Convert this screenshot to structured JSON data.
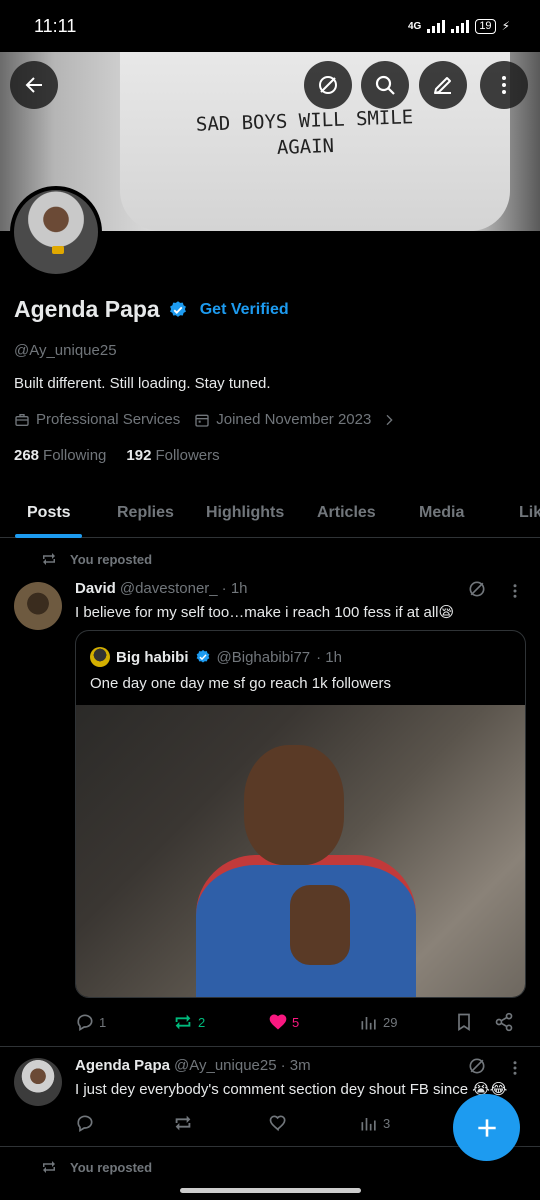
{
  "status_bar": {
    "time": "11:11",
    "network": "4G",
    "battery": "19"
  },
  "banner": {
    "shirt_text_line1": "SAD BOYS WILL SMILE",
    "shirt_text_line2": "AGAIN"
  },
  "profile": {
    "name": "Agenda Papa",
    "get_verified": "Get Verified",
    "handle": "@Ay_unique25",
    "bio": "Built different. Still loading. Stay tuned.",
    "category": "Professional Services",
    "joined": "Joined November 2023",
    "following_count": "268",
    "following_label": "Following",
    "followers_count": "192",
    "followers_label": "Followers"
  },
  "tabs": [
    {
      "label": "Posts",
      "active": true
    },
    {
      "label": "Replies"
    },
    {
      "label": "Highlights"
    },
    {
      "label": "Articles"
    },
    {
      "label": "Media"
    },
    {
      "label": "Lik"
    }
  ],
  "feed": [
    {
      "repost_label": "You reposted",
      "author": "David",
      "handle": "@davestoner_",
      "time": "· 1h",
      "text": "I believe for my self too…make i reach 100 fess if at all😪",
      "quote": {
        "author": "Big habibi",
        "handle": "@Bighabibi77",
        "time": "· 1h",
        "text": "One day one day me sf go reach 1k followers"
      },
      "replies": "1",
      "reposts": "2",
      "likes": "5",
      "views": "29"
    },
    {
      "author": "Agenda Papa",
      "handle": "@Ay_unique25",
      "time": "· 3m",
      "text": "I just dey everybody's comment section dey shout FB since 😭😂",
      "views": "3"
    },
    {
      "repost_label": "You reposted"
    }
  ],
  "colors": {
    "accent": "#1d9bf0",
    "repost_active": "#00ba7c",
    "like_active": "#f91880",
    "muted": "#71767b",
    "background": "#000000"
  }
}
